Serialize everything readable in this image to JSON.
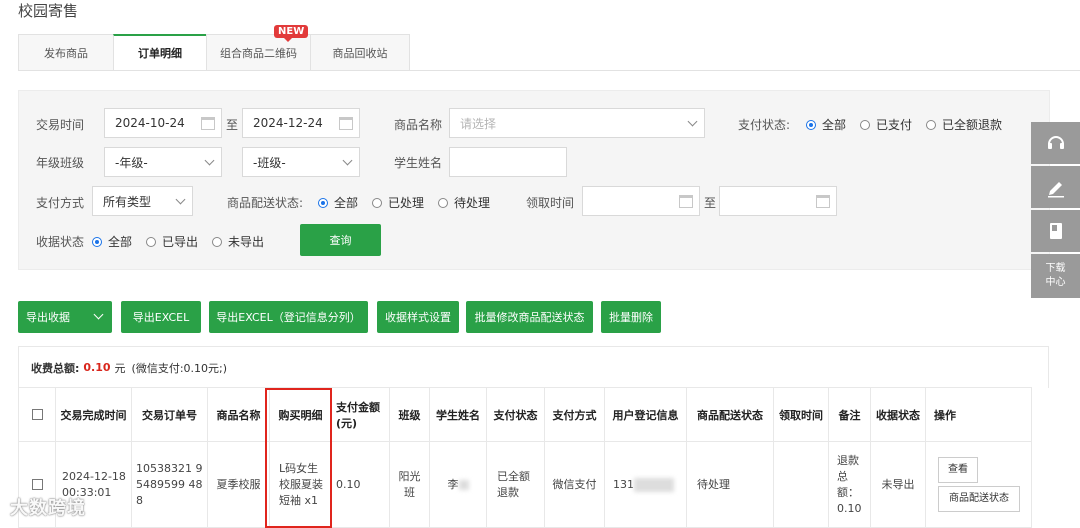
{
  "page_title": "校园寄售",
  "tabs": [
    {
      "label": "发布商品"
    },
    {
      "label": "订单明细"
    },
    {
      "label": "组合商品二维码"
    },
    {
      "label": "商品回收站"
    }
  ],
  "tab_badge": "NEW",
  "filters": {
    "trade_time_label": "交易时间",
    "trade_time_from": "2024-10-24",
    "to_text": "至",
    "trade_time_to": "2024-12-24",
    "product_name_label": "商品名称",
    "product_name_placeholder": "请选择",
    "pay_status_label": "支付状态:",
    "pay_status_options": [
      "全部",
      "已支付",
      "已全额退款"
    ],
    "grade_class_label": "年级班级",
    "grade_select": "-年级-",
    "class_select": "-班级-",
    "student_name_label": "学生姓名",
    "pay_method_label": "支付方式",
    "pay_method_select": "所有类型",
    "delivery_status_label": "商品配送状态:",
    "delivery_status_options": [
      "全部",
      "已处理",
      "待处理"
    ],
    "pickup_time_label": "领取时间",
    "collect_status_label": "收据状态",
    "collect_status_options": [
      "全部",
      "已导出",
      "未导出"
    ],
    "query_button": "查询"
  },
  "actions": {
    "export_receipt": "导出收据",
    "export_excel": "导出EXCEL",
    "export_excel_split": "导出EXCEL（登记信息分列）",
    "receipt_style": "收据样式设置",
    "batch_modify_delivery": "批量修改商品配送状态",
    "batch_delete": "批量删除"
  },
  "summary": {
    "label": "收费总额:",
    "amount": "0.10",
    "unit": "元",
    "detail": "(微信支付:0.10元;)"
  },
  "table": {
    "headers": [
      "交易完成时间",
      "交易订单号",
      "商品名称",
      "购买明细",
      "支付金额(元)",
      "班级",
      "学生姓名",
      "支付状态",
      "支付方式",
      "用户登记信息",
      "商品配送状态",
      "领取时间",
      "备注",
      "收据状态",
      "操作"
    ],
    "rows": [
      {
        "time": "2024-12-18 00:33:01",
        "order_no": "10538321 95489599 488",
        "product": "夏季校服",
        "detail": "L码女生校服夏装短袖 x1",
        "amount": "0.10",
        "class": "阳光班",
        "student": "李",
        "pay_status": "已全额退款",
        "pay_method": "微信支付",
        "user_info": "131",
        "delivery_status": "待处理",
        "pickup_time": "",
        "remark": "退款总额：0.10",
        "receipt_status": "未导出",
        "op_view": "查看",
        "op_delivery": "商品配送状态"
      }
    ]
  },
  "side_panel": {
    "download_center_line1": "下载",
    "download_center_line2": "中心"
  },
  "watermark": "大数跨境"
}
